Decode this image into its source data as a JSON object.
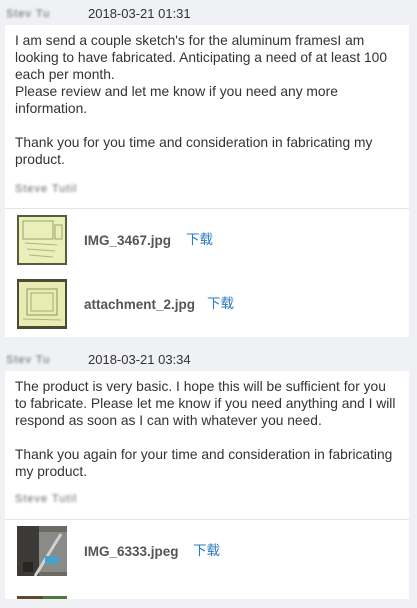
{
  "messages": [
    {
      "timestamp": "2018-03-21 01:31",
      "paragraphs": [
        "I am send a couple sketch's for the aluminum framesI am looking to have fabricated. Anticipating a need of at least 100 each per month.",
        "Please review and let me know if you need any more information.",
        "",
        "Thank you for you time and consideration in fabricating my product."
      ],
      "attachments": [
        {
          "filename": "IMG_3467.jpg",
          "download_label": "下载"
        },
        {
          "filename": "attachment_2.jpg",
          "download_label": "下载"
        }
      ]
    },
    {
      "timestamp": "2018-03-21 03:34",
      "paragraphs": [
        "The product is very basic. I hope this will be sufficient for you to fabricate. Please let me know if you need anything and I will respond as soon as I can with whatever you need.",
        "",
        "Thank you again for your time and consideration in fabricating my product."
      ],
      "attachments": [
        {
          "filename": "IMG_6333.jpeg",
          "download_label": "下载"
        }
      ]
    }
  ],
  "colors": {
    "link": "#2a7bc0",
    "background": "#f0f1f4",
    "card": "#ffffff"
  }
}
